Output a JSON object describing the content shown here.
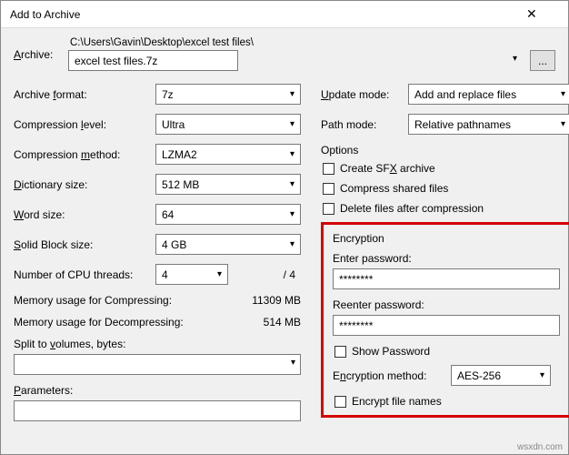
{
  "window": {
    "title": "Add to Archive"
  },
  "archive": {
    "label": "Archive:",
    "path": "C:\\Users\\Gavin\\Desktop\\excel test files\\",
    "filename": "excel test files.7z",
    "browse": "..."
  },
  "left": {
    "format_label": "Archive format:",
    "format_value": "7z",
    "level_label": "Compression level:",
    "level_value": "Ultra",
    "method_label": "Compression method:",
    "method_value": "LZMA2",
    "dict_label": "Dictionary size:",
    "dict_value": "512 MB",
    "word_label": "Word size:",
    "word_value": "64",
    "block_label": "Solid Block size:",
    "block_value": "4 GB",
    "threads_label": "Number of CPU threads:",
    "threads_value": "4",
    "threads_total": "/ 4",
    "mem_comp_label": "Memory usage for Compressing:",
    "mem_comp_value": "11309 MB",
    "mem_decomp_label": "Memory usage for Decompressing:",
    "mem_decomp_value": "514 MB",
    "split_label": "Split to volumes, bytes:",
    "split_value": "",
    "params_label": "Parameters:",
    "params_value": ""
  },
  "right": {
    "update_label": "Update mode:",
    "update_value": "Add and replace files",
    "path_label": "Path mode:",
    "path_value": "Relative pathnames",
    "options_title": "Options",
    "sfx_label": "Create SFX archive",
    "shared_label": "Compress shared files",
    "delete_label": "Delete files after compression"
  },
  "encryption": {
    "title": "Encryption",
    "enter_label": "Enter password:",
    "enter_value": "********",
    "reenter_label": "Reenter password:",
    "reenter_value": "********",
    "show_label": "Show Password",
    "method_label": "Encryption method:",
    "method_value": "AES-256",
    "encrypt_names_label": "Encrypt file names"
  },
  "watermark": "wsxdn.com"
}
